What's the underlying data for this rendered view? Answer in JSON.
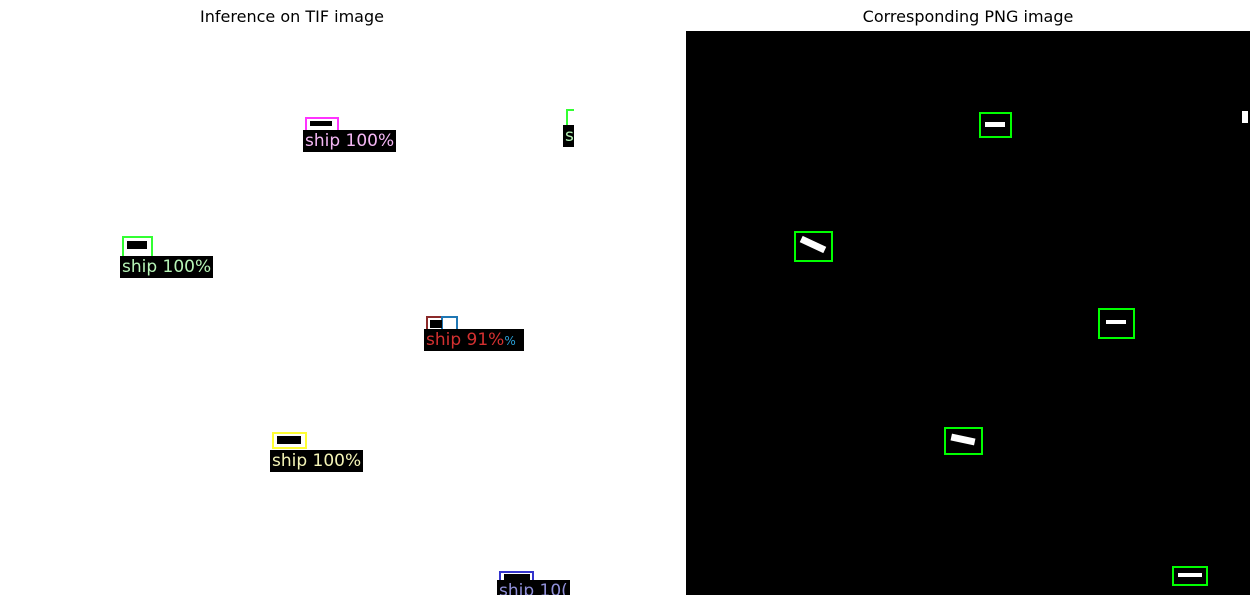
{
  "left_panel": {
    "title": "Inference on TIF image",
    "detections": [
      {
        "label": "ship 100%",
        "color": "#ff33ff",
        "text_color": "#f4b6f4"
      },
      {
        "label": "ship 100%",
        "color": "#33ff33",
        "text_color": "#b6f4b6"
      },
      {
        "label": "ship 91%",
        "color": "#8b2a2a",
        "text_color": "#d43030"
      },
      {
        "label": "%",
        "color": "#1f77b4",
        "text_color": "#2a9fd6"
      },
      {
        "label": "ship 100%",
        "color": "#ffff33",
        "text_color": "#f4f4b6"
      },
      {
        "label": "ship 10(",
        "color": "#3333cc",
        "text_color": "#8f8fd8"
      },
      {
        "label": "s",
        "color": "#33ff33",
        "text_color": "#b6f4b6"
      }
    ]
  },
  "right_panel": {
    "title": "Corresponding PNG image",
    "box_color": "#00ff00"
  }
}
